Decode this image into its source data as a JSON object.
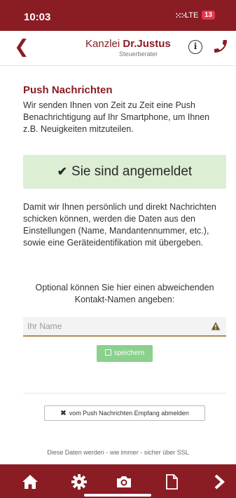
{
  "status_bar": {
    "time": "10:03",
    "signal": "⁙⁙",
    "network": "LTE",
    "battery": "13"
  },
  "header": {
    "brand_prefix": "Kanzlei ",
    "brand_name": "Dr.Justus",
    "brand_subtitle": "Steuerberater",
    "back_icon": "chevron-left-icon",
    "info_icon": "info-icon",
    "phone_icon": "phone-icon"
  },
  "main": {
    "title": "Push Nachrichten",
    "intro": "Wir senden Ihnen von Zeit zu Zeit eine Push Benachrichtigung auf Ihr Smartphone, um Ihnen z.B. Neuigkeiten mitzuteilen.",
    "status_label": "Sie sind angemeldet",
    "info_text": "Damit wir Ihnen persönlich und direkt Nachrichten schicken können, werden die Daten aus den Einstellungen (Name, Mandantennummer, etc.), sowie eine Geräteidentifikation mit übergeben.",
    "optional_text": "Optional können Sie hier einen abweichenden Kontakt-Namen angeben:",
    "name_placeholder": "Ihr Name",
    "name_value": "",
    "save_label": "speichern",
    "unsubscribe_label": "vom Push Nachrichten Empfang abmelden",
    "footer_note": "Diese Daten werden - wie immer - sicher über SSL"
  },
  "tabbar": {
    "items": [
      "home-icon",
      "gear-icon",
      "camera-icon",
      "document-icon",
      "chevron-right-icon"
    ]
  },
  "colors": {
    "brand": "#8a1c24",
    "success_bg": "#dceed4",
    "save_button": "#8bd08d",
    "warning": "#a98e4e",
    "battery": "#e8344b"
  }
}
